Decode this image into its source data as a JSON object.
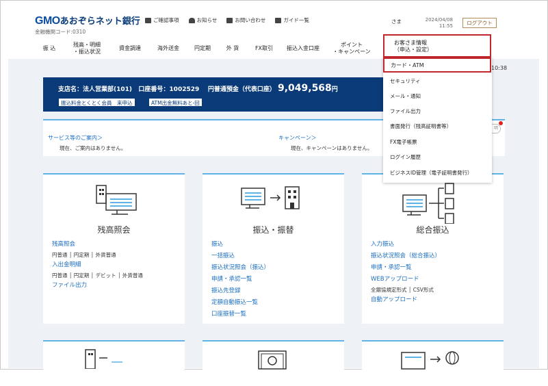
{
  "header": {
    "logo_brand": "GMO",
    "logo_bank": "あおぞらネット銀行",
    "bank_code": "金融機関コード:0310",
    "links": [
      {
        "label": "ご確認事項",
        "icon": "document-check-icon"
      },
      {
        "label": "お知らせ",
        "icon": "bell-icon"
      },
      {
        "label": "お問い合わせ",
        "icon": "mail-icon"
      },
      {
        "label": "ガイド一覧",
        "icon": "guide-book-icon"
      }
    ],
    "user_suffix": "さま",
    "date": "2024/04/08",
    "time": "11:55",
    "logout_label": "ログアウト"
  },
  "nav": [
    {
      "label": "振 込"
    },
    {
      "label": "残高・明細\n・振込状況"
    },
    {
      "label": "資金調達"
    },
    {
      "label": "海外送金"
    },
    {
      "label": "円定期"
    },
    {
      "label": "外 貨"
    },
    {
      "label": "FX取引"
    },
    {
      "label": "振込入金口座"
    },
    {
      "label": "ポイント\n・キャンペーン"
    }
  ],
  "dropdown": {
    "header_label_1": "お客さま情報",
    "header_label_2": "（申込・設定）",
    "highlighted_item": "カード・ATM",
    "items": [
      "セキュリティ",
      "メール・通知",
      "ファイル出力",
      "書面発行（残高証明書等）",
      "FX電子帳票",
      "ログイン履歴",
      "ビジネスID管理（電子証明書発行）"
    ]
  },
  "account": {
    "branch_label": "支店名：法人営業部(101)",
    "account_label": "口座番号：1002529",
    "balance_label": "円普通預金（代表口座）",
    "balance_amount": "9,049,568",
    "balance_unit": "円",
    "badge_1": "振込料金とくとく会員　来申込",
    "badge_2": "ATM出金無料あと-回"
  },
  "clock_fragment": "10:38",
  "notices": {
    "service_title": "サービス等のご案内＞",
    "service_text": "現在、ご案内はありません。",
    "campaign_title": "キャンペーン＞",
    "campaign_text": "現在、キャンペーンはありません。",
    "bell_fragment": "明"
  },
  "cards": [
    {
      "title": "残高照会",
      "icon": "building-monitor-icon",
      "rows": [
        {
          "link": "残高照会",
          "subs": "円普通 │ 円定期 │ 外貨普通"
        },
        {
          "link": "入出金明細",
          "subs": "円普通 │ 円定期 │ デビット │ 外貨普通"
        },
        {
          "link": "ファイル出力",
          "subs": ""
        }
      ]
    },
    {
      "title": "振込・振替",
      "icon": "monitor-arrow-building-icon",
      "links": [
        "振込",
        "一括振込",
        "振込状況照会（振込）",
        "申請・承認一覧",
        "振込先登録",
        "定額自動振込一覧",
        "口座振替一覧"
      ]
    },
    {
      "title": "総合振込",
      "icon": "monitor-multi-building-icon",
      "links": [
        "入力振込",
        "振込状況照会（総合振込）",
        "申請・承認一覧",
        "WEBアップロード"
      ],
      "sub_after_upload": "全銀協規定形式 │ CSV形式",
      "last_link": "自動アップロード"
    }
  ]
}
